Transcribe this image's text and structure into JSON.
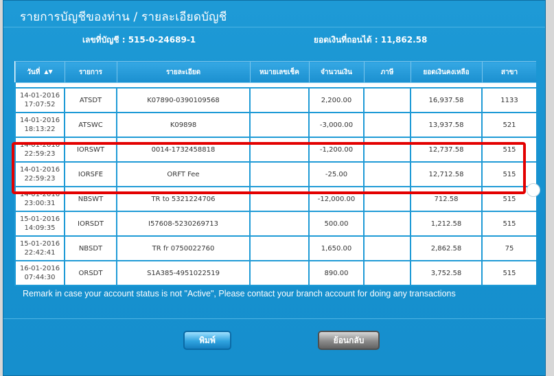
{
  "dialog": {
    "title": "รายการบัญชีของท่าน / รายละเอียดบัญชี",
    "account_label": "เลขที่บัญชี : 515-0-24689-1",
    "balance_label": "ยอดเงินที่ถอนได้ : 11,862.58"
  },
  "table": {
    "headers": [
      "วันที่",
      "รายการ",
      "รายละเอียด",
      "หมายเลขเช็ค",
      "จำนวนเงิน",
      "ภาษี",
      "ยอดเงินคงเหลือ",
      "สาขา"
    ],
    "rows": [
      {
        "date": "14-01-2016",
        "time": "17:07:52",
        "type": "ATSDT",
        "detail": "K07890-0390109568",
        "cheque": "",
        "amount": "2,200.00",
        "tax": "",
        "balance": "16,937.58",
        "branch": "1133"
      },
      {
        "date": "14-01-2016",
        "time": "18:13:22",
        "type": "ATSWC",
        "detail": "K09898",
        "cheque": "",
        "amount": "-3,000.00",
        "tax": "",
        "balance": "13,937.58",
        "branch": "521"
      },
      {
        "date": "14-01-2016",
        "time": "22:59:23",
        "type": "IORSWT",
        "detail": "0014-1732458818",
        "cheque": "",
        "amount": "-1,200.00",
        "tax": "",
        "balance": "12,737.58",
        "branch": "515"
      },
      {
        "date": "14-01-2016",
        "time": "22:59:23",
        "type": "IORSFE",
        "detail": "ORFT Fee",
        "cheque": "",
        "amount": "-25.00",
        "tax": "",
        "balance": "12,712.58",
        "branch": "515"
      },
      {
        "date": "14-01-2016",
        "time": "23:00:31",
        "type": "NBSWT",
        "detail": "TR to 5321224706",
        "cheque": "",
        "amount": "-12,000.00",
        "tax": "",
        "balance": "712.58",
        "branch": "515"
      },
      {
        "date": "15-01-2016",
        "time": "14:09:35",
        "type": "IORSDT",
        "detail": "I57608-5230269713",
        "cheque": "",
        "amount": "500.00",
        "tax": "",
        "balance": "1,212.58",
        "branch": "515"
      },
      {
        "date": "15-01-2016",
        "time": "22:42:41",
        "type": "NBSDT",
        "detail": "TR fr 0750022760",
        "cheque": "",
        "amount": "1,650.00",
        "tax": "",
        "balance": "2,862.58",
        "branch": "75"
      },
      {
        "date": "16-01-2016",
        "time": "07:44:30",
        "type": "ORSDT",
        "detail": "S1A385-4951022519",
        "cheque": "",
        "amount": "890.00",
        "tax": "",
        "balance": "3,752.58",
        "branch": "515"
      }
    ]
  },
  "remark": "Remark in case your account status is not \"Active\", Please contact your branch account for doing any transactions",
  "buttons": {
    "print": "พิมพ์",
    "back": "ย้อนกลับ"
  },
  "icons": {
    "sort": "sort-icon",
    "close": "close-icon"
  },
  "colors": {
    "dialog_bg": "#1590cf",
    "highlight": "#e30000"
  }
}
